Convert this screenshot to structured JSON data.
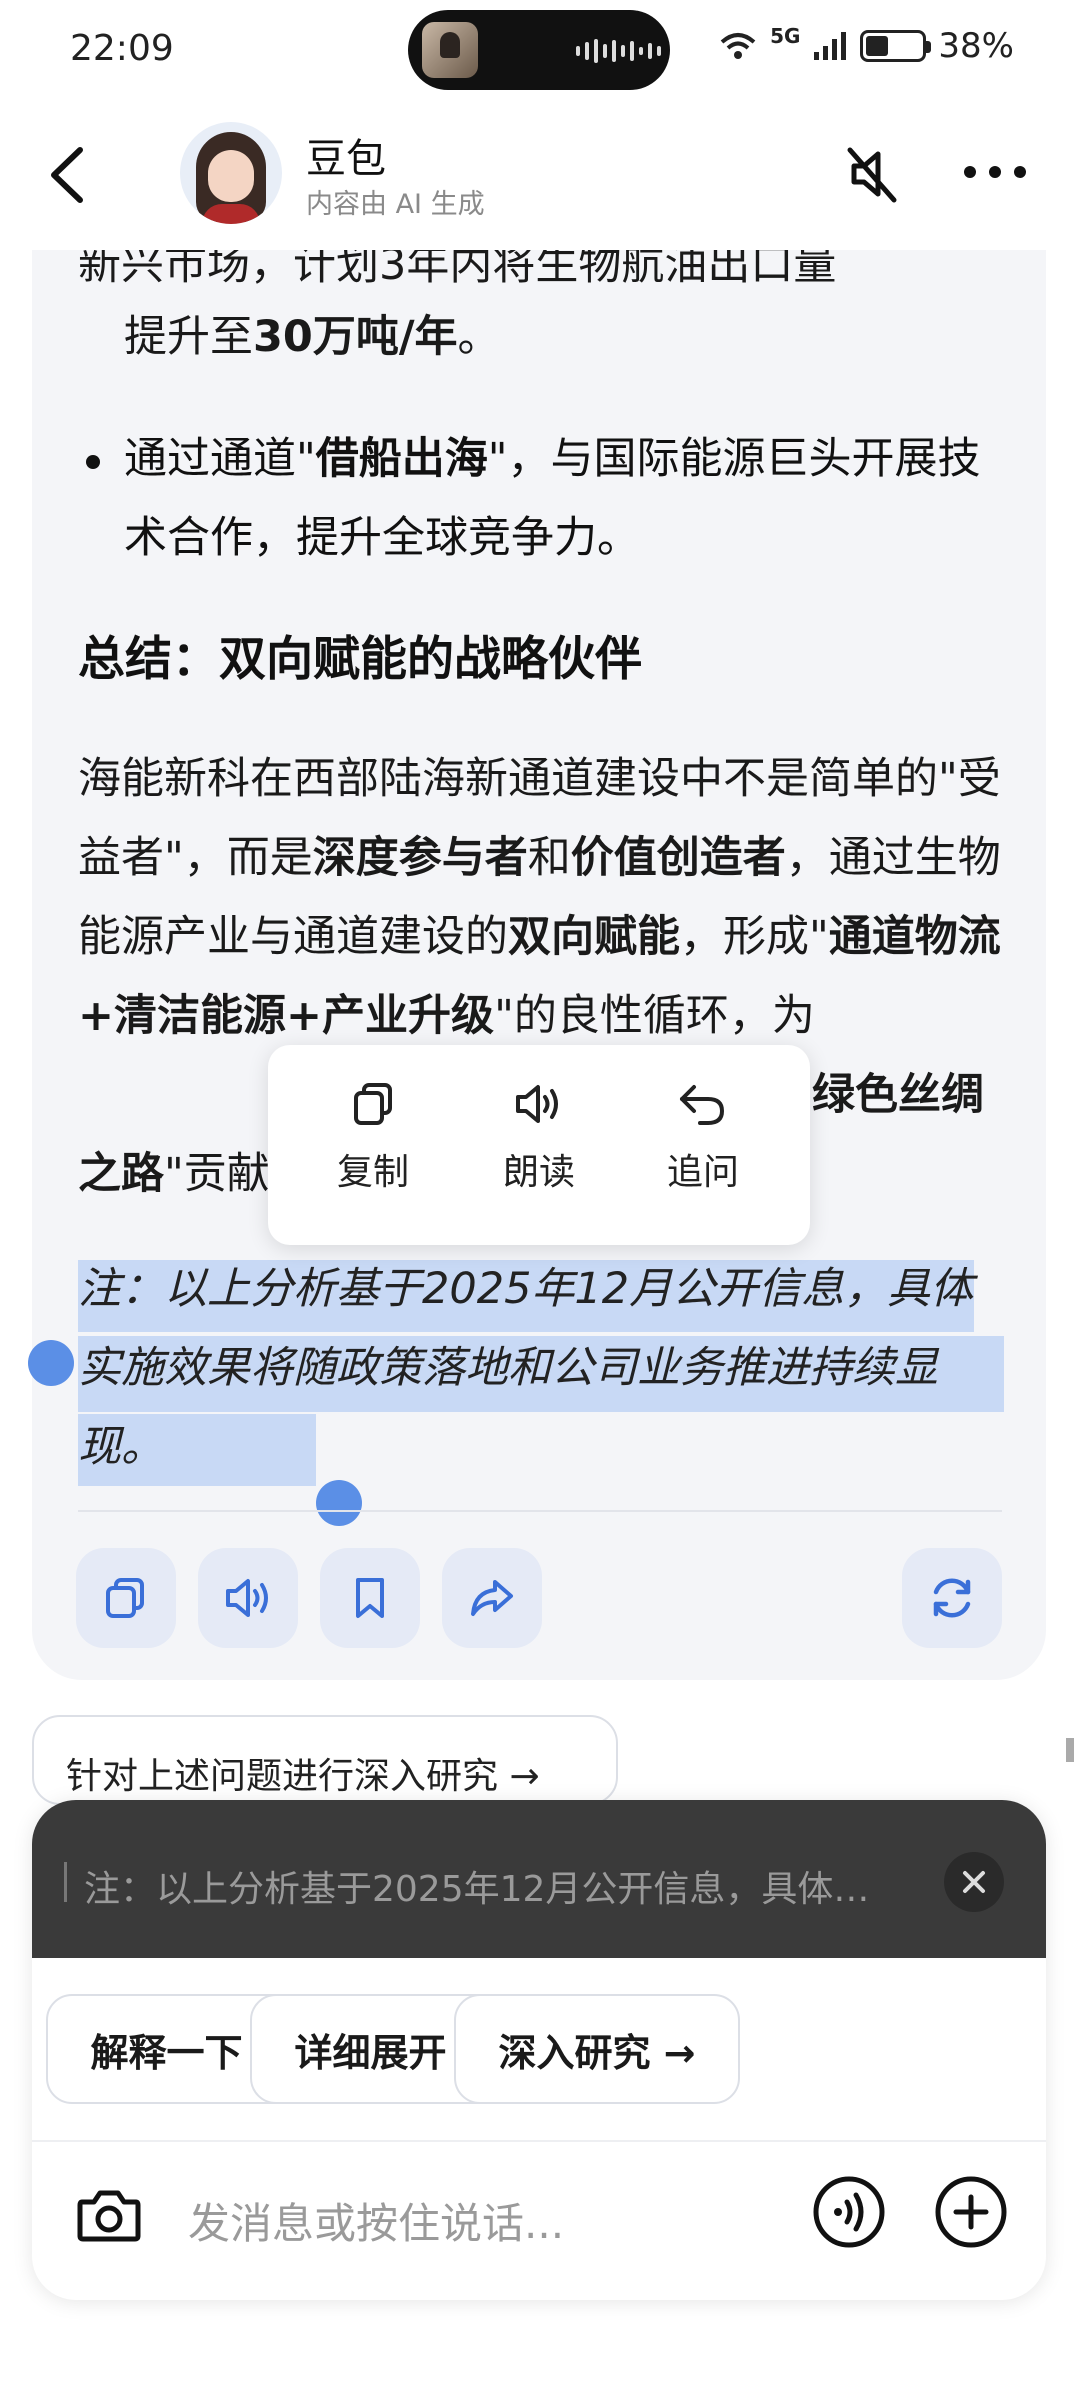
{
  "status": {
    "time": "22:09",
    "signal_label": "5G",
    "battery": "38%"
  },
  "header": {
    "bot_name": "豆包",
    "subtitle": "内容由 AI 生成"
  },
  "message": {
    "line_partial": "新兴市场，计划3年内将生物航油出口量",
    "line_2a": "提升至",
    "line_2b": "30万吨/年",
    "line_2c": "。",
    "bullet_a": "通过通道\"",
    "bullet_b": "借船出海",
    "bullet_c": "\"，与国际能源巨头开展技术合作，提升全球竞争力。",
    "heading": "总结：双向赋能的战略伙伴",
    "para": [
      {
        "t": "海能新科在西部陆海新通道建设中不是简单的\"受益者\"，而是",
        "b": false
      },
      {
        "t": "深度参与者",
        "b": true
      },
      {
        "t": "和",
        "b": false
      },
      {
        "t": "价值创造者",
        "b": true
      },
      {
        "t": "，通过生物能源产业与通道建设的",
        "b": false
      },
      {
        "t": "双向赋能",
        "b": true
      },
      {
        "t": "，形成\"",
        "b": false
      },
      {
        "t": "通道物流+清洁能源+产业升级",
        "b": true
      },
      {
        "t": "\"的良性循环，为",
        "b": false
      }
    ],
    "para_hidden_right": "绿色丝绸",
    "para_last_a": "之路",
    "para_last_b": "\"贡献",
    "note": "注：以上分析基于2025年12月公开信息，具体实施效果将随政策落地和公司业务推进持续显现。"
  },
  "popup": {
    "copy": "复制",
    "read": "朗读",
    "ask": "追问"
  },
  "actions": [
    "copy-icon",
    "speaker-icon",
    "bookmark-icon",
    "share-icon",
    "refresh-icon"
  ],
  "research_chip": "针对上述问题进行深入研究 →",
  "composer": {
    "quote": "注：以上分析基于2025年12月公开信息，具体…",
    "chips": [
      "解释一下 →",
      "详细展开 →",
      "深入研究 →"
    ],
    "placeholder": "发消息或按住说话..."
  },
  "colors": {
    "accent": "#3a6fd8",
    "selection": "#c8d9f5",
    "card": "#f4f5f8"
  }
}
